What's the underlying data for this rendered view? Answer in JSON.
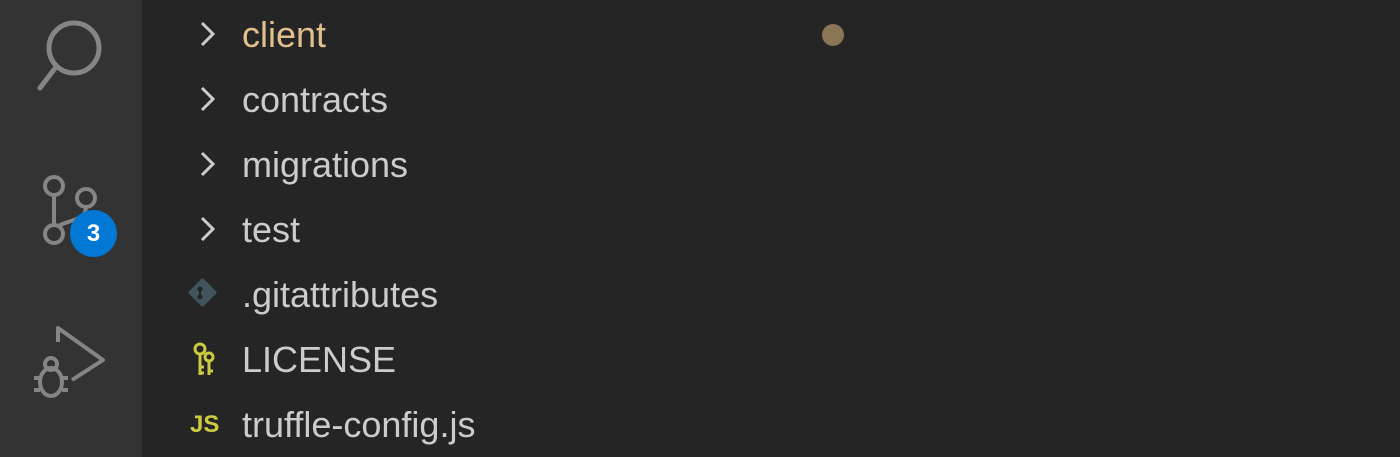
{
  "activity_bar": {
    "items": [
      {
        "name": "search",
        "icon": "search-icon"
      },
      {
        "name": "source-control",
        "icon": "source-control-icon",
        "badge": "3"
      },
      {
        "name": "run-and-debug",
        "icon": "run-debug-icon"
      }
    ],
    "badge_color": "#0078d4"
  },
  "explorer": {
    "items": [
      {
        "label": "client",
        "type": "folder",
        "icon": "chevron-right-icon",
        "modified": true
      },
      {
        "label": "contracts",
        "type": "folder",
        "icon": "chevron-right-icon"
      },
      {
        "label": "migrations",
        "type": "folder",
        "icon": "chevron-right-icon"
      },
      {
        "label": "test",
        "type": "folder",
        "icon": "chevron-right-icon"
      },
      {
        "label": ".gitattributes",
        "type": "file",
        "icon": "git-icon"
      },
      {
        "label": "LICENSE",
        "type": "file",
        "icon": "license-key-icon"
      },
      {
        "label": "truffle-config.js",
        "type": "file",
        "icon": "js-icon",
        "icon_text": "JS"
      }
    ]
  },
  "colors": {
    "activity_bar_bg": "#333333",
    "sidebar_bg": "#252526",
    "text": "#cccccc",
    "modified_text": "#e2c08d",
    "modified_dot": "#8a7556",
    "js_icon": "#cbcb41",
    "git_icon": "#41535b",
    "license_icon": "#cbcb41"
  }
}
